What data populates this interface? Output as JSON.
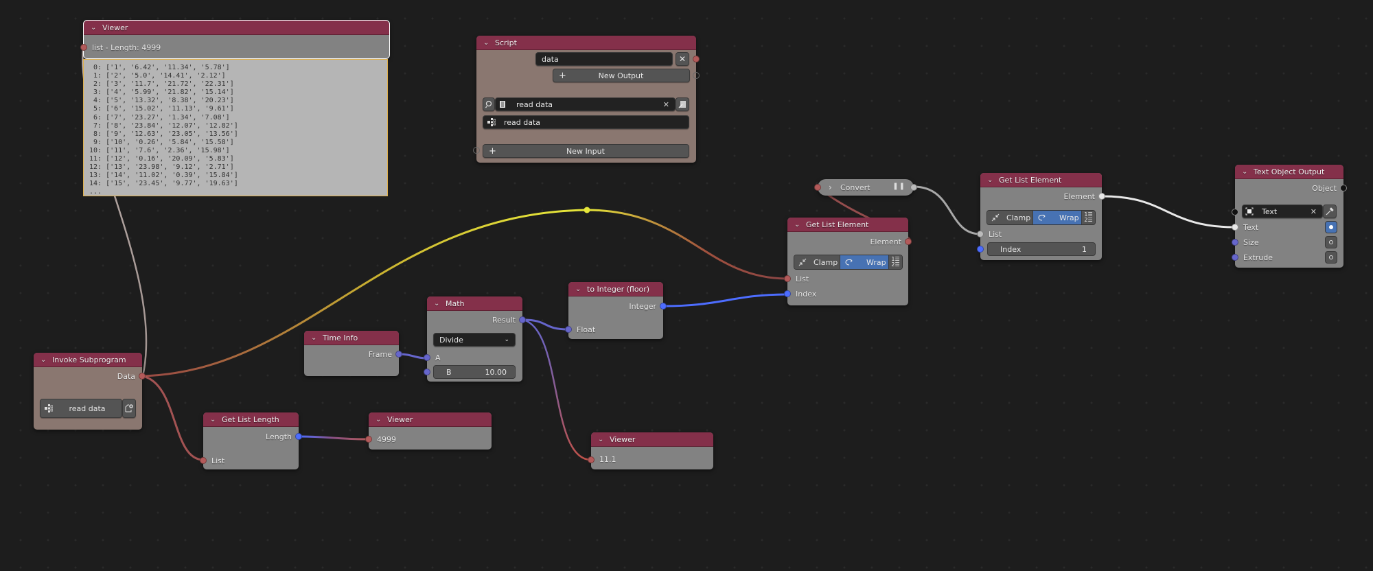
{
  "colors": {
    "background": "#1d1d1d",
    "node_header": "#84304a",
    "node_body": "#828282",
    "subprogram_body": "#8a7770",
    "accent_blue": "#4772b3",
    "link_list": "#b35a5a",
    "link_float": "#6666cc",
    "link_integer": "#4d6dff",
    "link_reroute": "#e6e63a",
    "link_object": "#e8e8e8"
  },
  "nodes": {
    "viewer_list": {
      "title": "Viewer",
      "label": "list - Length: 4999",
      "lines": [
        " 0: ['1', '6.42', '11.34', '5.78']",
        " 1: ['2', '5.0', '14.41', '2.12']",
        " 2: ['3', '11.7', '21.72', '22.31']",
        " 3: ['4', '5.99', '21.82', '15.14']",
        " 4: ['5', '13.32', '8.38', '20.23']",
        " 5: ['6', '15.02', '11.13', '9.61']",
        " 6: ['7', '23.27', '1.34', '7.08']",
        " 7: ['8', '23.84', '12.07', '12.82']",
        " 8: ['9', '12.63', '23.05', '13.56']",
        " 9: ['10', '0.26', '5.84', '15.58']",
        "10: ['11', '7.6', '2.36', '15.98']",
        "11: ['12', '0.16', '20.09', '5.83']",
        "12: ['13', '23.98', '9.12', '2.71']",
        "13: ['14', '11.02', '0.39', '15.84']",
        "14: ['15', '23.45', '9.77', '19.63']",
        "..."
      ]
    },
    "script": {
      "title": "Script",
      "output_name": "data",
      "new_output_label": "New Output",
      "script_name": "read data",
      "subprogram_name": "read data",
      "new_input_label": "New Input"
    },
    "invoke_subprogram": {
      "title": "Invoke Subprogram",
      "output_label": "Data",
      "subprogram_name": "read data"
    },
    "get_list_length": {
      "title": "Get List Length",
      "output_label": "Length",
      "input_label": "List"
    },
    "viewer_length": {
      "title": "Viewer",
      "value": "4999"
    },
    "time_info": {
      "title": "Time Info",
      "output_label": "Frame"
    },
    "math": {
      "title": "Math",
      "output_label": "Result",
      "operation": "Divide",
      "input_a_label": "A",
      "input_b_label": "B",
      "input_b_value": "10.00"
    },
    "to_integer": {
      "title": "to Integer (floor)",
      "output_label": "Integer",
      "input_label": "Float"
    },
    "viewer_float": {
      "title": "Viewer",
      "value": "11.1"
    },
    "convert": {
      "title": "Convert"
    },
    "get_list_element_1": {
      "title": "Get List Element",
      "output_label": "Element",
      "clamp_label": "Clamp",
      "wrap_label": "Wrap",
      "list_label": "List",
      "index_label": "Index"
    },
    "get_list_element_2": {
      "title": "Get List Element",
      "output_label": "Element",
      "clamp_label": "Clamp",
      "wrap_label": "Wrap",
      "list_label": "List",
      "index_label": "Index",
      "index_value": "1"
    },
    "text_object_output": {
      "title": "Text Object Output",
      "output_label": "Object",
      "object_name": "Text",
      "text_label": "Text",
      "size_label": "Size",
      "extrude_label": "Extrude",
      "text_toggle_on": true,
      "size_toggle_on": false,
      "extrude_toggle_on": false
    }
  }
}
